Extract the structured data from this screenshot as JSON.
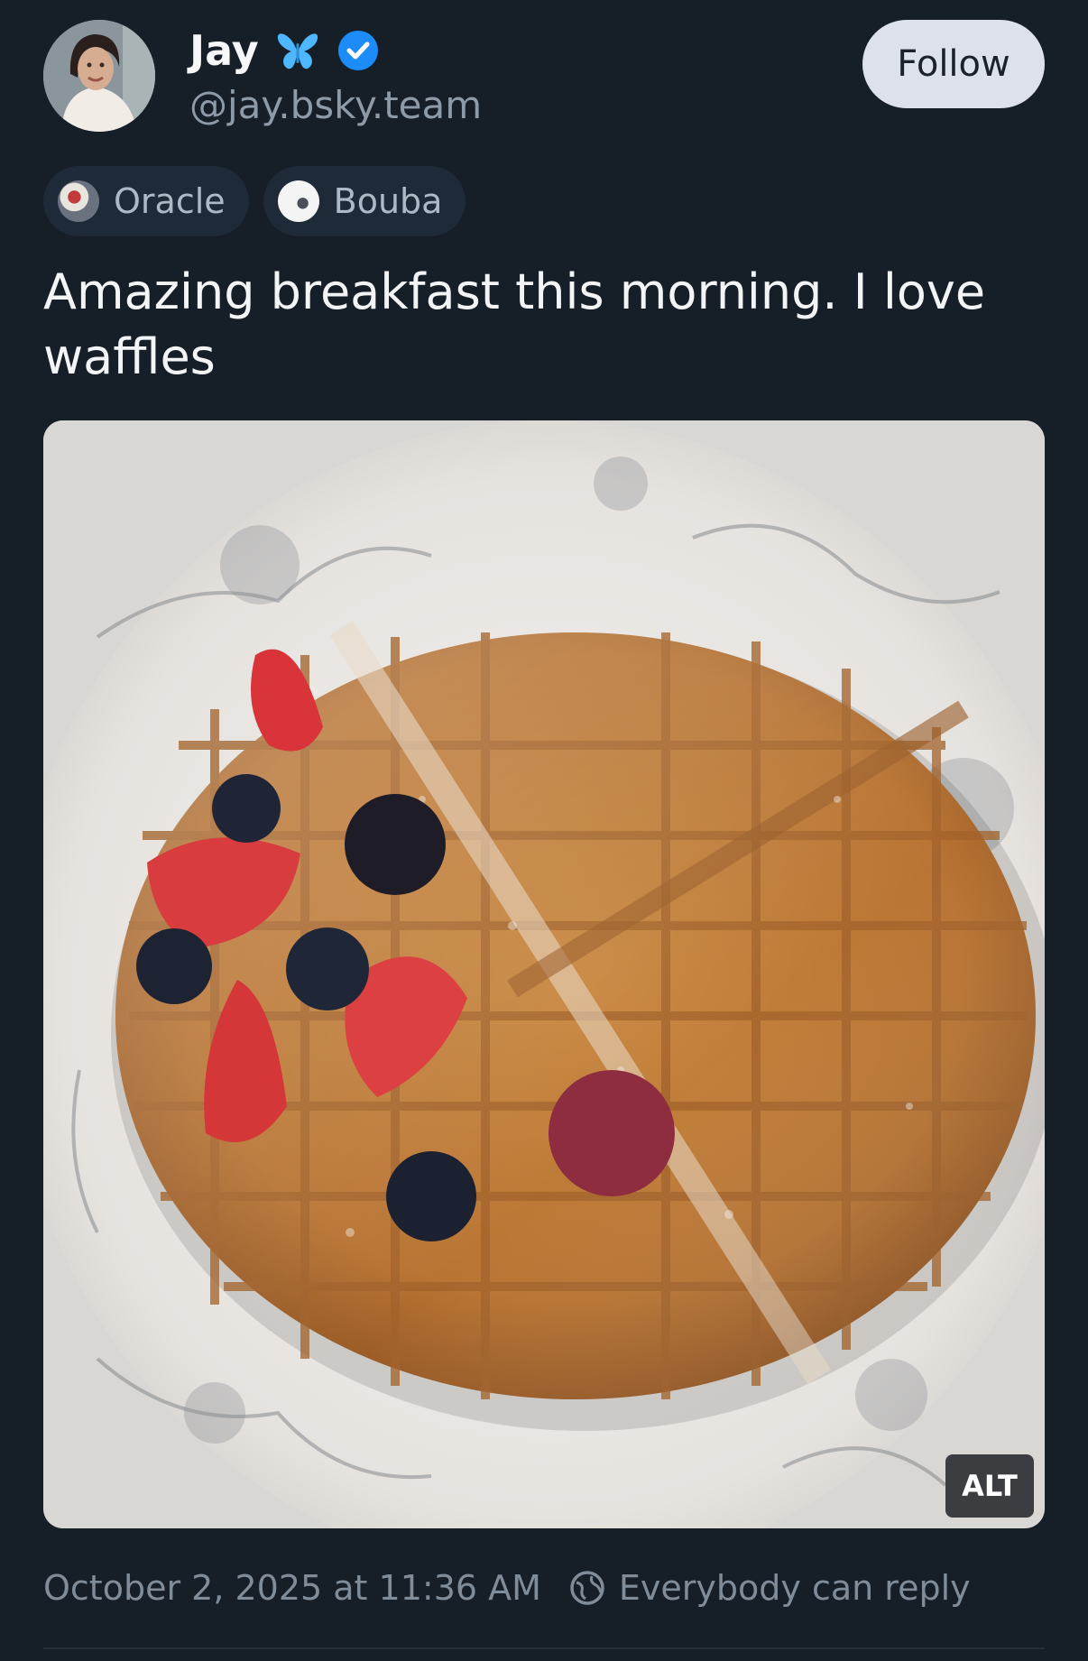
{
  "author": {
    "name": "Jay",
    "handle": "@jay.bsky.team",
    "emoji": "butterfly-icon",
    "verified": true
  },
  "follow_button": {
    "label": "Follow"
  },
  "labels": [
    {
      "label": "Oracle",
      "icon": "oracle-avatar"
    },
    {
      "label": "Bouba",
      "icon": "bouba-avatar"
    }
  ],
  "post": {
    "text": "Amazing breakfast this morning. I love waffles",
    "image_alt_badge": "ALT"
  },
  "footer": {
    "timestamp": "October 2, 2025 at 11:36 AM",
    "reply_setting": "Everybody can reply"
  },
  "colors": {
    "background": "#161e27",
    "handle": "#8d9aa8",
    "verified": "#1d8cf8",
    "butterfly": "#4db8ff",
    "follow_bg": "#dde2ea",
    "chip_bg": "#1e2a37",
    "meta": "#7f8c99"
  }
}
